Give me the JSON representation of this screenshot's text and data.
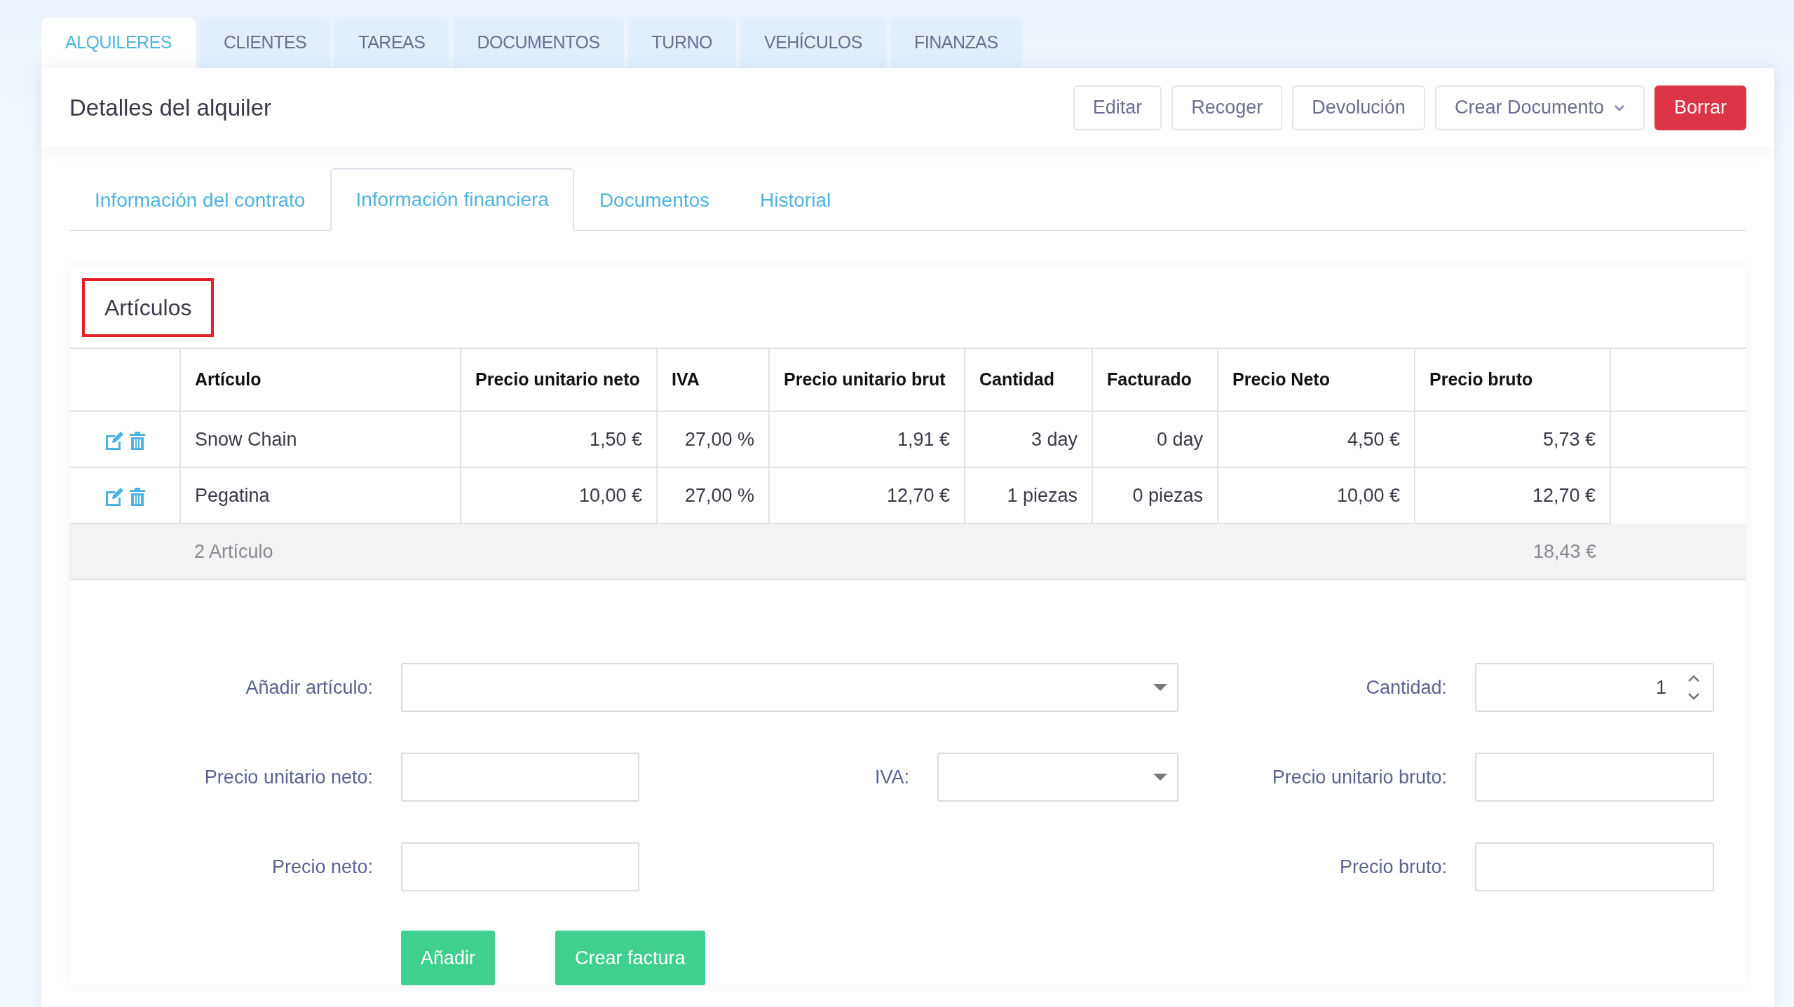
{
  "main_tabs": [
    {
      "label": "ALQUILERES",
      "selected": true
    },
    {
      "label": "CLIENTES",
      "selected": false
    },
    {
      "label": "TAREAS",
      "selected": false
    },
    {
      "label": "DOCUMENTOS",
      "selected": false
    },
    {
      "label": "TURNO",
      "selected": false
    },
    {
      "label": "VEHÍCULOS",
      "selected": false
    },
    {
      "label": "FINANZAS",
      "selected": false
    }
  ],
  "header": {
    "title": "Detalles del alquiler",
    "actions": [
      {
        "label": "Editar",
        "kind": "outline"
      },
      {
        "label": "Recoger",
        "kind": "outline"
      },
      {
        "label": "Devolución",
        "kind": "outline"
      },
      {
        "label": "Crear Documento",
        "kind": "dropdown"
      },
      {
        "label": "Borrar",
        "kind": "danger"
      }
    ]
  },
  "sub_tabs": [
    {
      "label": "Información del contrato",
      "selected": false
    },
    {
      "label": "Información financiera",
      "selected": true
    },
    {
      "label": "Documentos",
      "selected": false
    },
    {
      "label": "Historial",
      "selected": false
    }
  ],
  "section": {
    "title": "Artículos"
  },
  "table": {
    "columns": [
      "Artículo",
      "Precio unitario neto",
      "IVA",
      "Precio unitario brut",
      "Cantidad",
      "Facturado",
      "Precio Neto",
      "Precio bruto"
    ],
    "rows": [
      [
        "Snow Chain",
        "1,50 €",
        "27,00 %",
        "1,91 €",
        "3 day",
        "0 day",
        "4,50 €",
        "5,73 €"
      ],
      [
        "Pegatina",
        "10,00 €",
        "27,00 %",
        "12,70 €",
        "1 piezas",
        "0 piezas",
        "10,00 €",
        "12,70 €"
      ]
    ],
    "footer": {
      "count": "2 Artículo",
      "total": "18,43 €"
    }
  },
  "form": {
    "fields": [
      {
        "label": "Añadir artículo:",
        "kind": "select"
      },
      {
        "label": "Cantidad:",
        "kind": "number",
        "value": "1"
      },
      {
        "label": "Precio unitario neto:",
        "kind": "text"
      },
      {
        "label": "IVA:",
        "kind": "select"
      },
      {
        "label": "Precio unitario bruto:",
        "kind": "text"
      },
      {
        "label": "Precio neto:",
        "kind": "text"
      },
      {
        "label": "Precio bruto:",
        "kind": "text"
      }
    ],
    "buttons": [
      "Añadir",
      "Crear factura"
    ]
  }
}
